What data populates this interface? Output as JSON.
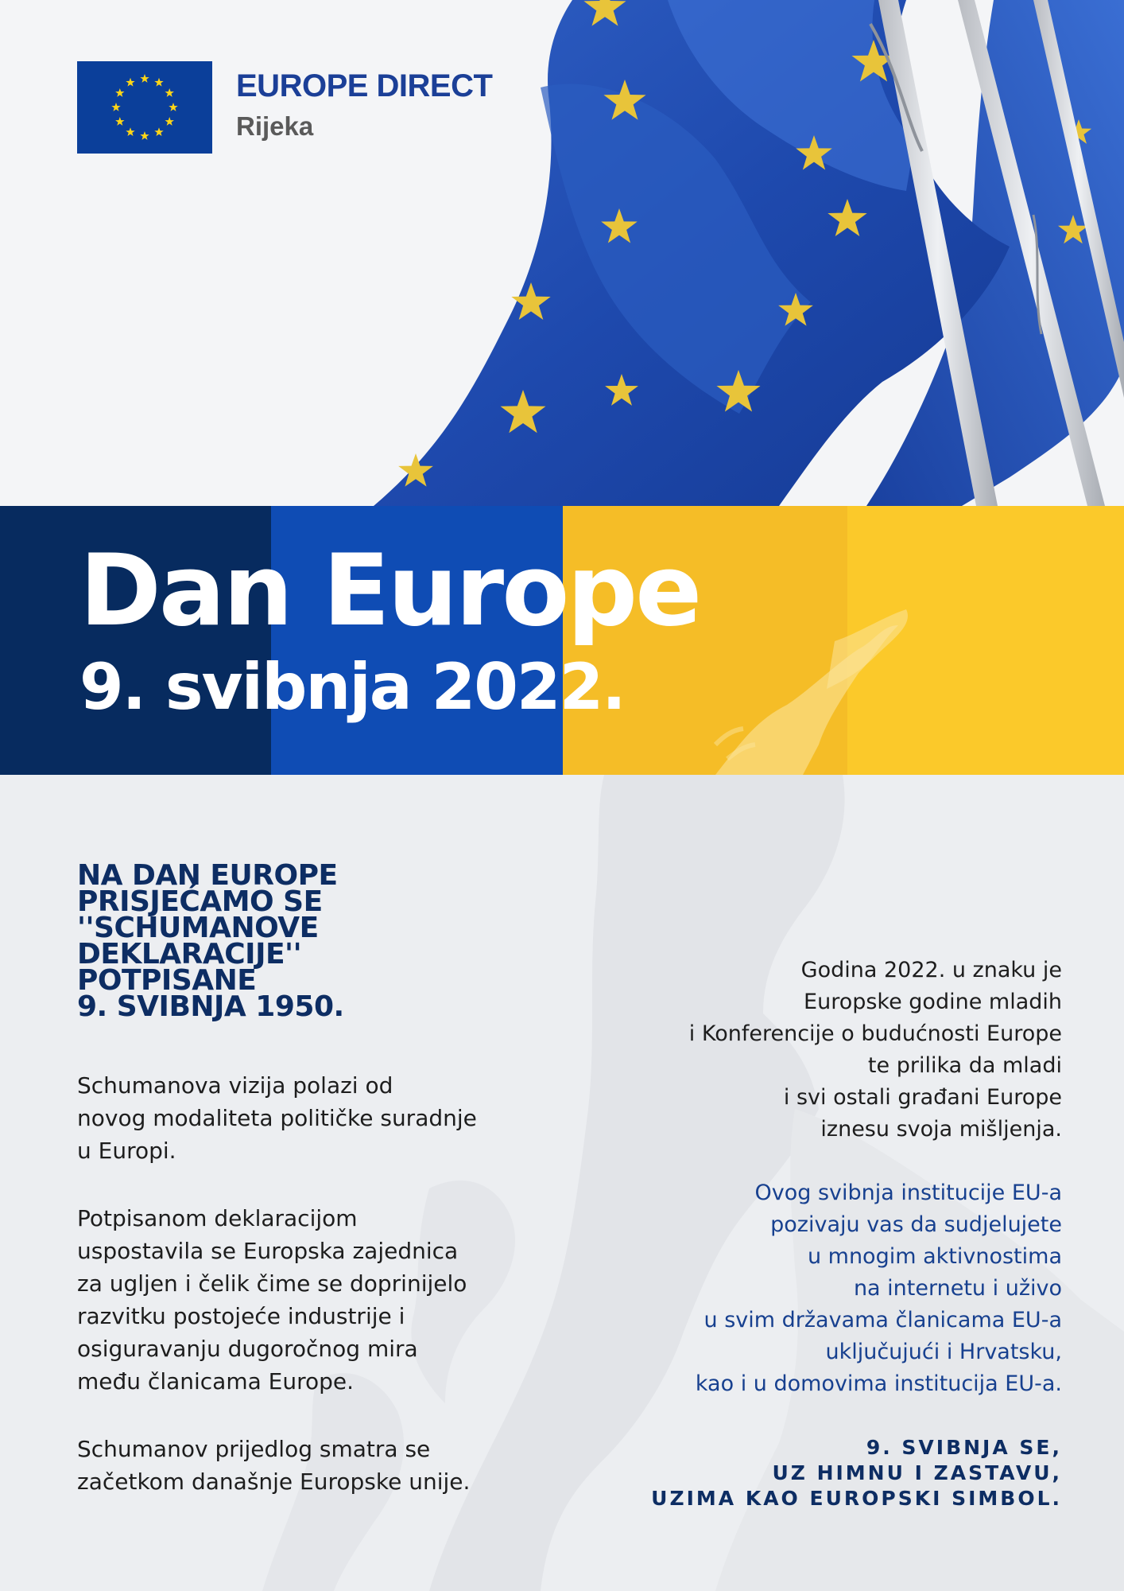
{
  "logo": {
    "title": "EUROPE DIRECT",
    "subtitle": "Rijeka"
  },
  "banner": {
    "title": "Dan Europe",
    "date": "9. svibnja 2022."
  },
  "left": {
    "heading": "NA DAN EUROPE\nPRISJEĆAMO SE\n''SCHUMANOVE\nDEKLARACIJE''\nPOTPISANE\n9. SVIBNJA 1950.",
    "paragraph_1": "Schumanova vizija polazi od\nnovog modaliteta političke suradnje\nu Europi.",
    "paragraph_2": "Potpisanom deklaracijom\nuspostavila se Europska zajednica\nza ugljen i čelik čime se doprinijelo\nrazvitku postojeće industrije i\nosiguravanju dugoročnog mira\nmeđu članicama Europe.",
    "paragraph_3": "Schumanov prijedlog smatra se\nzačetkom današnje Europske unije."
  },
  "right": {
    "paragraph_1": "Godina 2022. u znaku je\nEuropske godine mladih\ni Konferencije o budućnosti Europe\nte prilika da mladi\ni svi ostali građani Europe\niznesu svoja mišljenja.",
    "paragraph_2": "Ovog svibnja institucije EU-a\npozivaju vas da sudjelujete\nu mnogim aktivnostima\nna internetu i uživo\nu svim državama članicama EU-a\nuključujući i Hrvatsku,\nkao i u domovima institucija EU-a.",
    "closing": "9. SVIBNJA SE,\nUZ HIMNU I ZASTAVU,\nUZIMA KAO EUROPSKI SIMBOL."
  },
  "colors": {
    "navy": "#072b5f",
    "blue": "#0f4cb4",
    "yellow": "#f5bd27",
    "heading": "#0d2d63",
    "accent_text": "#17408f"
  },
  "icons": {
    "logo_flag": "eu-flag-icon",
    "hero_image": "eu-flags-photo",
    "background_map": "europe-map-watermark"
  }
}
